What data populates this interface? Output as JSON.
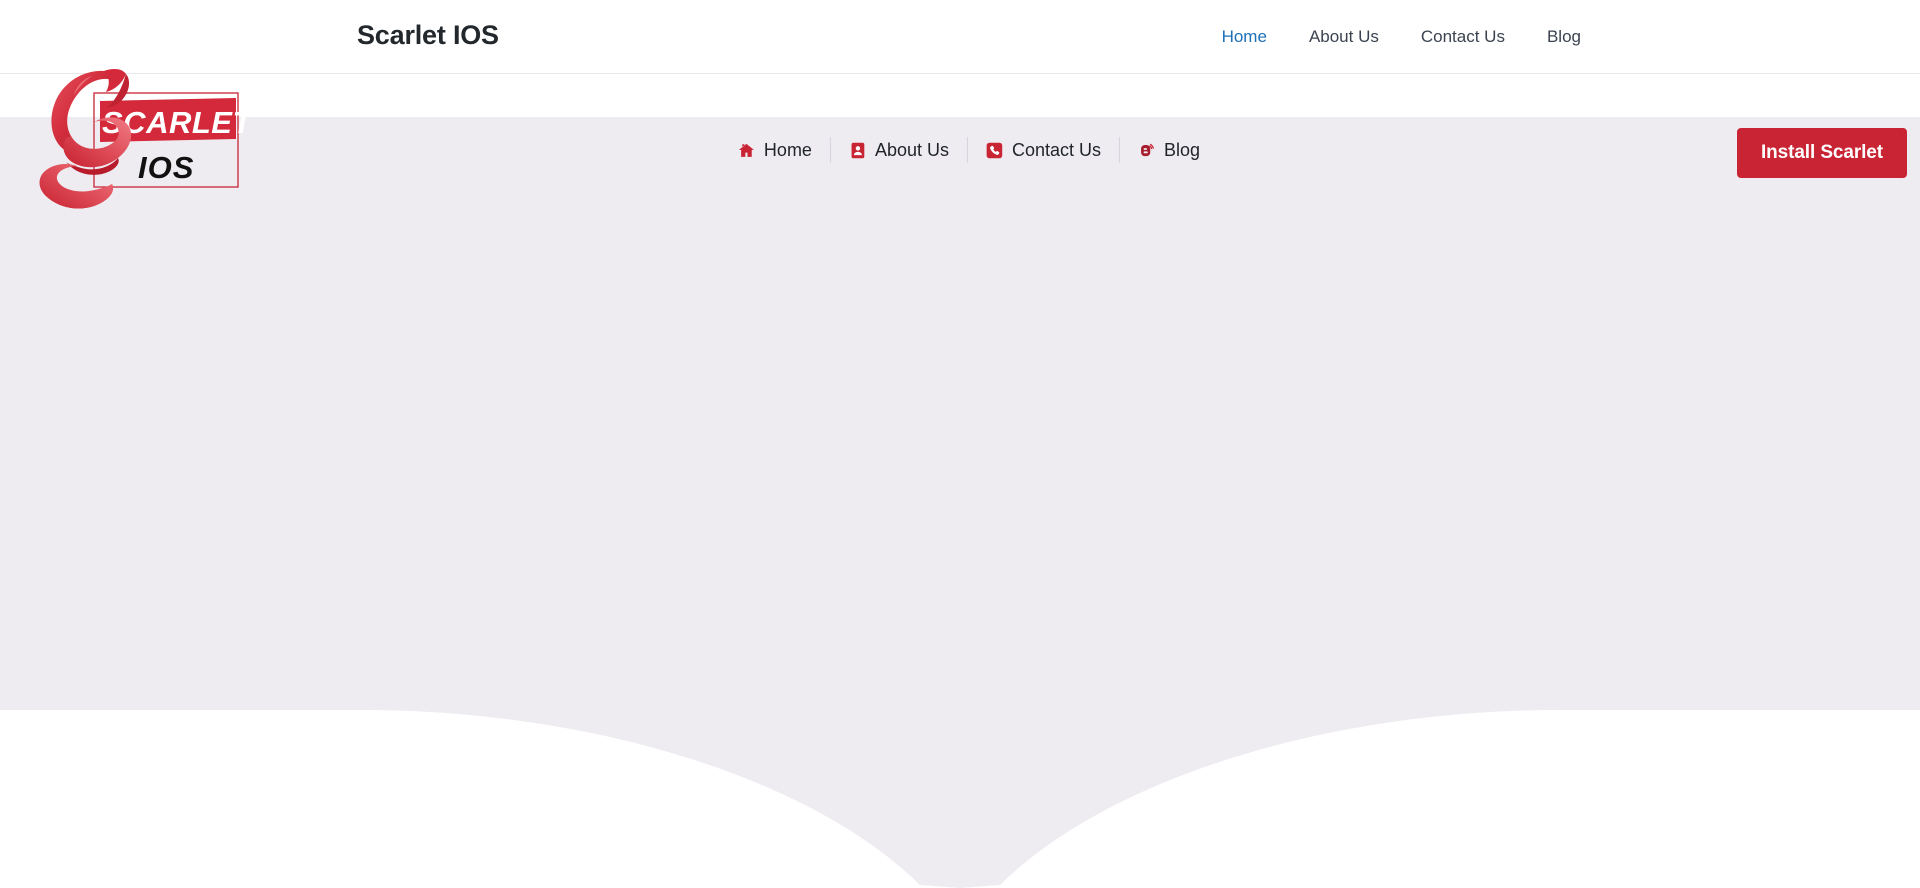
{
  "page": {
    "background_color": "#ffffff",
    "hero_color": "#eeecf1",
    "brand_red": "#c92434",
    "accent_blue": "#1d6fb8"
  },
  "header": {
    "site_title": "Scarlet IOS",
    "nav": [
      {
        "label": "Home",
        "active": true
      },
      {
        "label": "About Us",
        "active": false
      },
      {
        "label": "Contact Us",
        "active": false
      },
      {
        "label": "Blog",
        "active": false
      }
    ]
  },
  "logo": {
    "word_top": "SCARLET",
    "word_bottom": "IOS",
    "mark": "stylized-s-swoosh"
  },
  "hero": {
    "nav": [
      {
        "label": "Home",
        "icon": "home-icon"
      },
      {
        "label": "About Us",
        "icon": "address-card-icon"
      },
      {
        "label": "Contact Us",
        "icon": "phone-square-icon"
      },
      {
        "label": "Blog",
        "icon": "blogger-icon"
      }
    ],
    "cta": {
      "label": "Install Scarlet"
    }
  }
}
